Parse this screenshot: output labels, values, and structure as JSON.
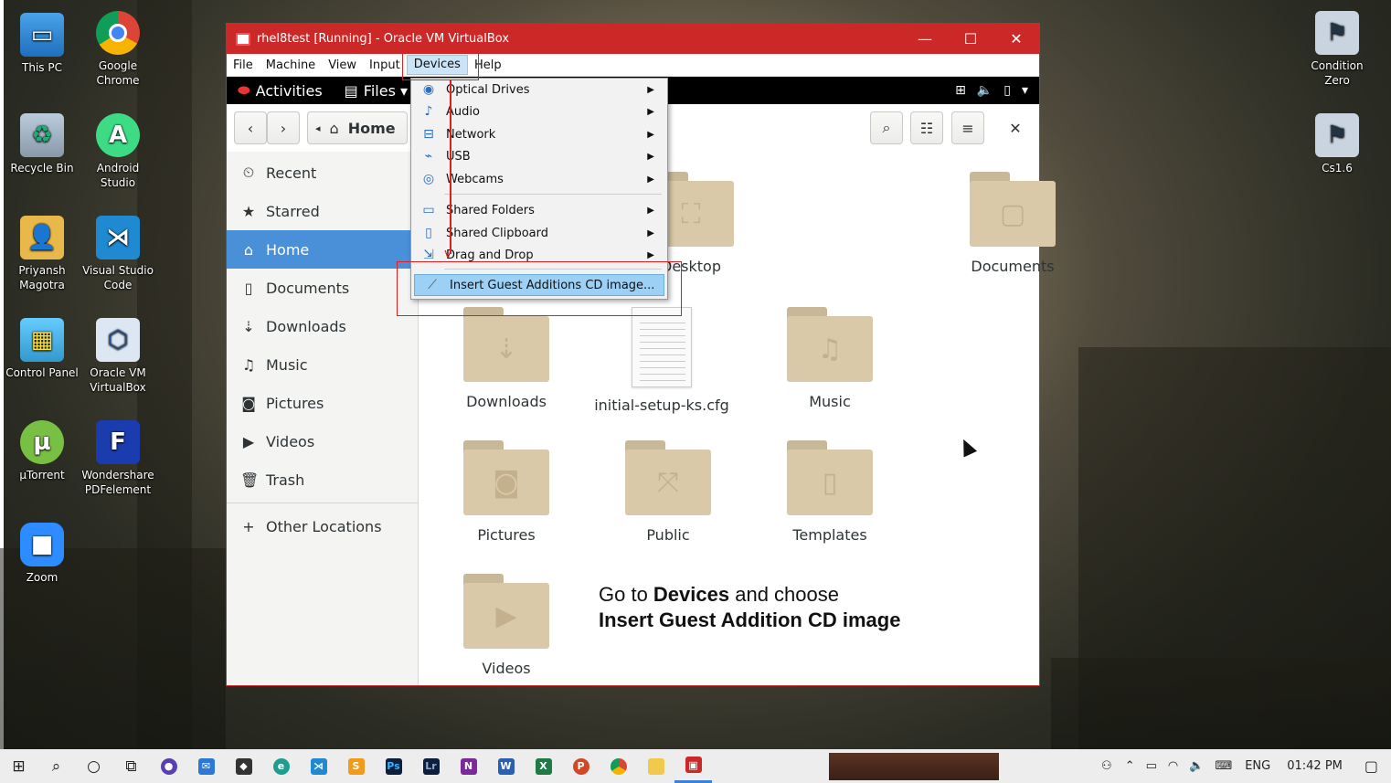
{
  "desktop": {
    "left_icons": [
      {
        "label": "This PC"
      },
      {
        "label": "Google Chrome"
      },
      {
        "label": "Recycle Bin"
      },
      {
        "label": "Android Studio"
      },
      {
        "label": "Priyansh Magotra"
      },
      {
        "label": "Visual Studio Code"
      },
      {
        "label": "Control Panel"
      },
      {
        "label": "Oracle VM VirtualBox"
      },
      {
        "label": "µTorrent"
      },
      {
        "label": "Wondershare PDFelement"
      },
      {
        "label": "Zoom"
      }
    ],
    "right_icons": [
      {
        "label": "Condition Zero"
      },
      {
        "label": "Cs1.6"
      }
    ]
  },
  "vm": {
    "title": "rhel8test [Running] - Oracle VM VirtualBox",
    "menu": [
      "File",
      "Machine",
      "View",
      "Input",
      "Devices",
      "Help"
    ],
    "gnome": {
      "activities": "Activities",
      "files": "Files ▾"
    },
    "path_label": "Home",
    "sidebar": [
      "Recent",
      "Starred",
      "Home",
      "Documents",
      "Downloads",
      "Music",
      "Pictures",
      "Videos",
      "Trash",
      "Other Locations"
    ],
    "files": [
      "Desktop",
      "Documents",
      "Downloads",
      "initial-setup-ks.cfg",
      "Music",
      "Pictures",
      "Public",
      "Templates",
      "Videos"
    ],
    "devices_menu": [
      "Optical Drives",
      "Audio",
      "Network",
      "USB",
      "Webcams",
      "Shared Folders",
      "Shared Clipboard",
      "Drag and Drop",
      "Insert Guest Additions CD image..."
    ]
  },
  "caption": {
    "line1_a": "Go to ",
    "line1_b": "Devices",
    "line1_c": " and choose",
    "line2": "Insert Guest Addition CD image"
  },
  "taskbar": {
    "lang": "ENG",
    "time": "01:42 PM"
  },
  "colors": {
    "titlebar": "#cc2828",
    "selection": "#4a90d9",
    "menu_highlight": "#9dd0f5",
    "annotation": "#e02020"
  }
}
